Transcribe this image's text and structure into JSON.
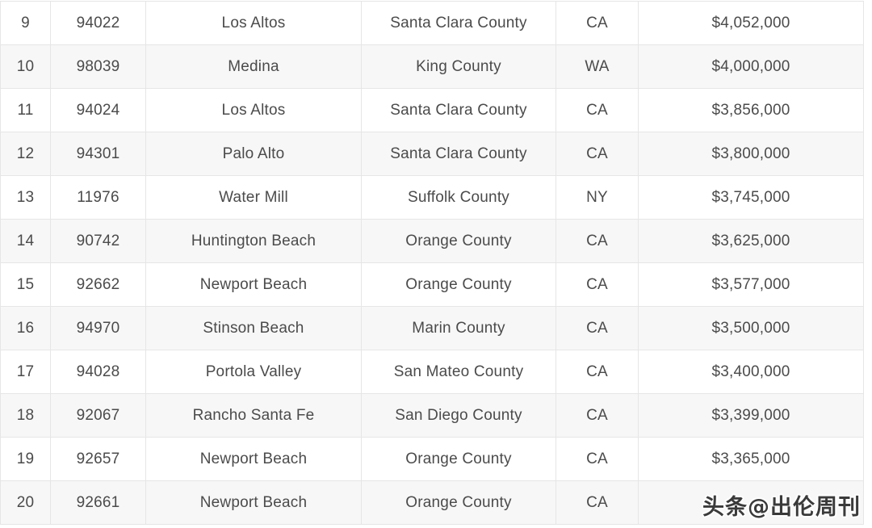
{
  "table": {
    "columns": [
      {
        "key": "rank",
        "name": "rank-column"
      },
      {
        "key": "zip",
        "name": "zip-column"
      },
      {
        "key": "city",
        "name": "city-column"
      },
      {
        "key": "county",
        "name": "county-column"
      },
      {
        "key": "state",
        "name": "state-column"
      },
      {
        "key": "price",
        "name": "price-column"
      }
    ],
    "rows": [
      {
        "rank": "9",
        "zip": "94022",
        "city": "Los Altos",
        "county": "Santa Clara County",
        "state": "CA",
        "price": "$4,052,000"
      },
      {
        "rank": "10",
        "zip": "98039",
        "city": "Medina",
        "county": "King County",
        "state": "WA",
        "price": "$4,000,000"
      },
      {
        "rank": "11",
        "zip": "94024",
        "city": "Los Altos",
        "county": "Santa Clara County",
        "state": "CA",
        "price": "$3,856,000"
      },
      {
        "rank": "12",
        "zip": "94301",
        "city": "Palo Alto",
        "county": "Santa Clara County",
        "state": "CA",
        "price": "$3,800,000"
      },
      {
        "rank": "13",
        "zip": "11976",
        "city": "Water Mill",
        "county": "Suffolk County",
        "state": "NY",
        "price": "$3,745,000"
      },
      {
        "rank": "14",
        "zip": "90742",
        "city": "Huntington Beach",
        "county": "Orange County",
        "state": "CA",
        "price": "$3,625,000"
      },
      {
        "rank": "15",
        "zip": "92662",
        "city": "Newport Beach",
        "county": "Orange County",
        "state": "CA",
        "price": "$3,577,000"
      },
      {
        "rank": "16",
        "zip": "94970",
        "city": "Stinson Beach",
        "county": "Marin County",
        "state": "CA",
        "price": "$3,500,000"
      },
      {
        "rank": "17",
        "zip": "94028",
        "city": "Portola Valley",
        "county": "San Mateo County",
        "state": "CA",
        "price": "$3,400,000"
      },
      {
        "rank": "18",
        "zip": "92067",
        "city": "Rancho Santa Fe",
        "county": "San Diego County",
        "state": "CA",
        "price": "$3,399,000"
      },
      {
        "rank": "19",
        "zip": "92657",
        "city": "Newport Beach",
        "county": "Orange County",
        "state": "CA",
        "price": "$3,365,000"
      },
      {
        "rank": "20",
        "zip": "92661",
        "city": "Newport Beach",
        "county": "Orange County",
        "state": "CA",
        "price": ""
      }
    ]
  },
  "watermark": {
    "text": "头条@出伦周刊"
  },
  "colors": {
    "row_odd_bg": "#ffffff",
    "row_even_bg": "#f7f7f7",
    "border": "#e6e6e6",
    "text": "#4b4b4b",
    "watermark_text": "#2b2b2b",
    "watermark_outline": "#ffffff"
  }
}
